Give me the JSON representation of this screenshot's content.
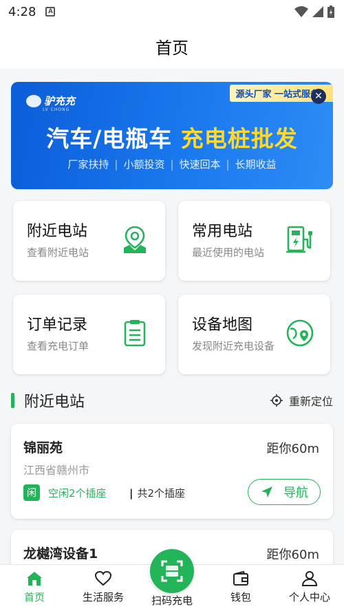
{
  "statusbar": {
    "time": "4:28"
  },
  "header": {
    "title": "首页"
  },
  "banner": {
    "logo_text": "驴充充",
    "logo_sub": "LV CHONG",
    "tag": "源头厂家 一站式服务",
    "headline_white": "汽车/电瓶车 ",
    "headline_yellow": "充电桩批发",
    "points": [
      "厂家扶持",
      "小额投资",
      "快速回本",
      "长期收益"
    ]
  },
  "features": [
    {
      "title": "附近电站",
      "desc": "查看附近电站",
      "icon": "map-pin-icon"
    },
    {
      "title": "常用电站",
      "desc": "最近使用的电站",
      "icon": "charger-icon"
    },
    {
      "title": "订单记录",
      "desc": "查看充电订单",
      "icon": "clipboard-icon"
    },
    {
      "title": "设备地图",
      "desc": "发现附近充电设备",
      "icon": "globe-pin-icon"
    }
  ],
  "nearby": {
    "section_title": "附近电站",
    "relocate_label": "重新定位",
    "stations": [
      {
        "name": "锦丽苑",
        "distance": "距你60m",
        "address": "江西省赣州市",
        "status_badge": "闲",
        "free": "空闲2个插座",
        "total": "共2个插座",
        "nav_label": "导航"
      },
      {
        "name": "龙樾湾设备1",
        "distance": "距你60m"
      }
    ]
  },
  "tabbar": {
    "items": [
      {
        "label": "首页",
        "icon": "home-icon",
        "active": true
      },
      {
        "label": "生活服务",
        "icon": "heart-icon"
      },
      {
        "label": "扫码充电",
        "icon": "scan-icon"
      },
      {
        "label": "钱包",
        "icon": "wallet-icon"
      },
      {
        "label": "个人中心",
        "icon": "user-icon"
      }
    ]
  },
  "colors": {
    "accent": "#23b45a",
    "banner_blue": "#1a79ee",
    "banner_yellow": "#ffd92c"
  }
}
